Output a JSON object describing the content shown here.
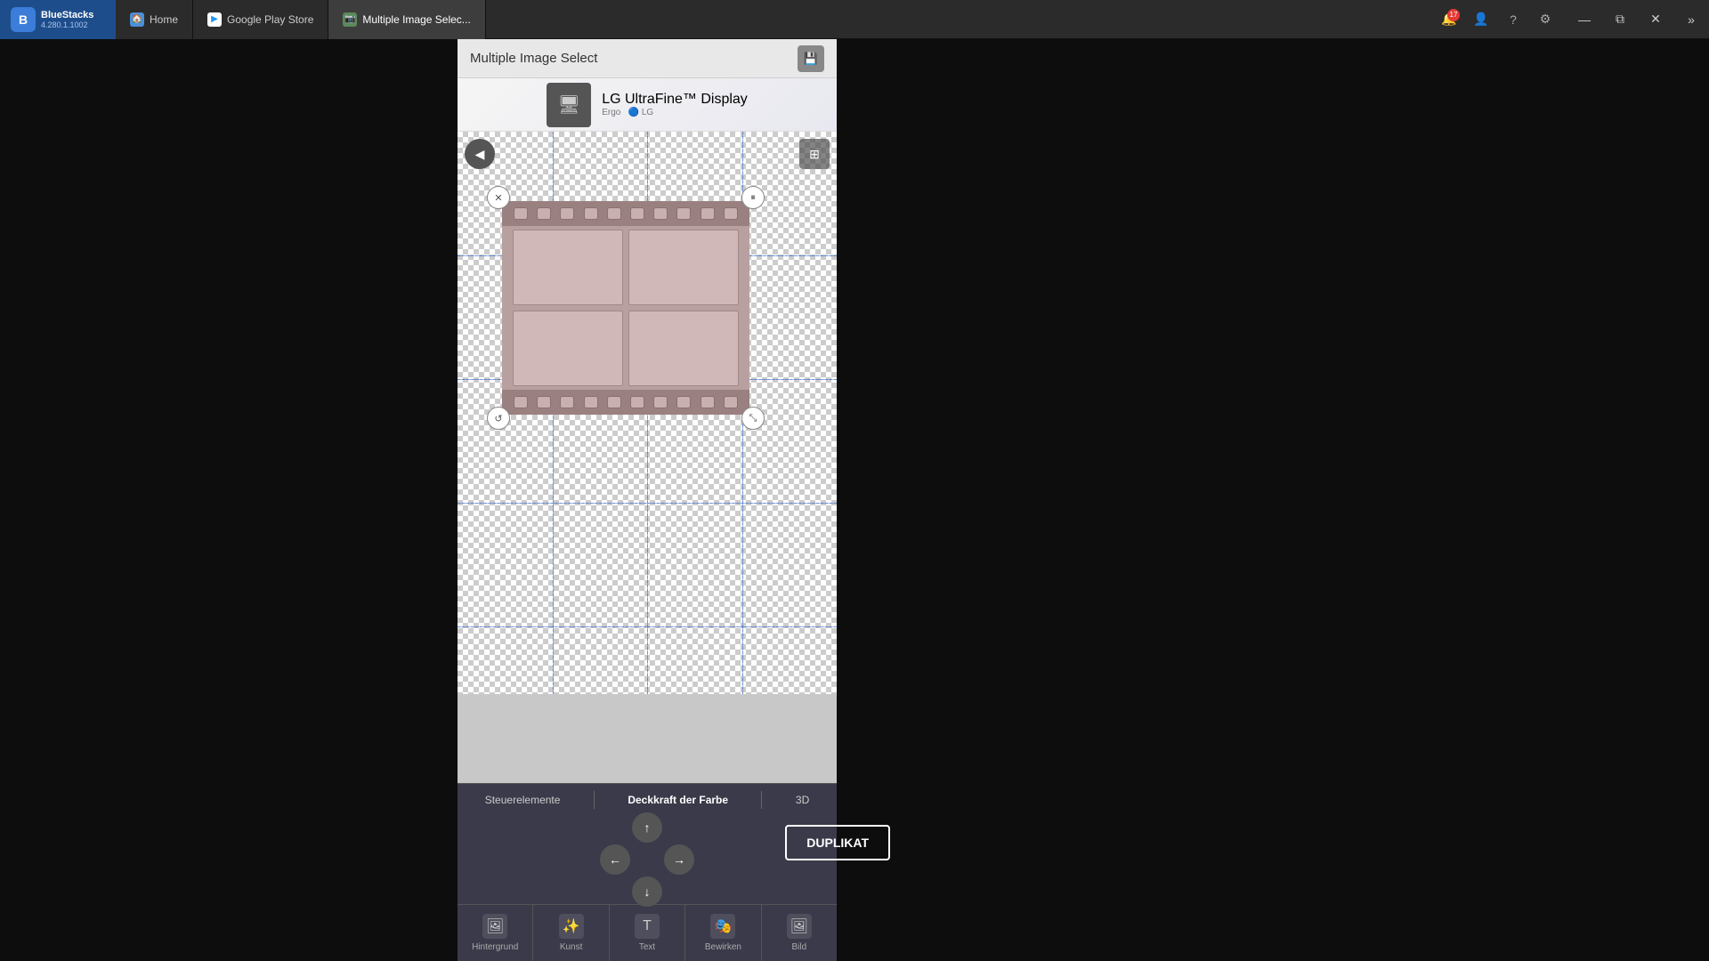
{
  "app": {
    "name": "BlueStacks",
    "version": "4.280.1.1002"
  },
  "taskbar": {
    "tabs": [
      {
        "id": "home",
        "label": "Home",
        "icon": "🏠",
        "active": false
      },
      {
        "id": "google-play",
        "label": "Google Play Store",
        "icon": "▶",
        "active": false
      },
      {
        "id": "app",
        "label": "Multiple Image Selec...",
        "icon": "📷",
        "active": true
      }
    ],
    "actions": {
      "notification_count": "17",
      "profile_icon": "👤",
      "help_icon": "?",
      "settings_icon": "⚙"
    },
    "window_controls": {
      "minimize": "—",
      "restore": "⧉",
      "close": "✕",
      "expand": "»"
    }
  },
  "window": {
    "title": "Multiple Image Select",
    "save_label": "💾"
  },
  "ad": {
    "brand": "LG UltraFine™ Display",
    "model": "Ergo",
    "logo": "🖥"
  },
  "canvas": {
    "back_btn": "◀",
    "grid_btn": "⊞"
  },
  "controls": {
    "up": "↑",
    "down": "↓",
    "left": "←",
    "right": "→",
    "duplikat": "DUPLIKAT"
  },
  "bottom_nav_tabs": [
    {
      "id": "steuerelemente",
      "label": "Steuerelemente",
      "active": false
    },
    {
      "id": "deckkraft",
      "label": "Deckkraft der Farbe",
      "active": false
    },
    {
      "id": "3d",
      "label": "3D",
      "active": false
    }
  ],
  "tool_tabs": [
    {
      "id": "hintergrund",
      "label": "Hintergrund",
      "icon": "🖼"
    },
    {
      "id": "kunst",
      "label": "Kunst",
      "icon": "✨"
    },
    {
      "id": "text",
      "label": "Text",
      "icon": "T"
    },
    {
      "id": "bewirken",
      "label": "Bewirken",
      "icon": "🎭"
    },
    {
      "id": "bild",
      "label": "Bild",
      "icon": "🖼"
    }
  ],
  "handles": {
    "close_icon": "✕",
    "pause_icon": "⏸",
    "rotate_left_icon": "↺",
    "resize_icon": "⤡"
  }
}
